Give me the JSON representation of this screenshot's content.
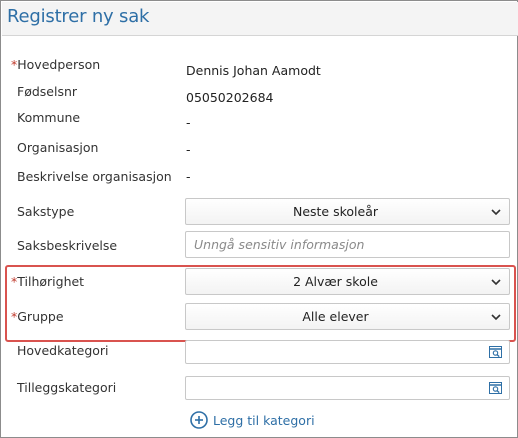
{
  "window": {
    "title": "Registrer ny sak"
  },
  "colors": {
    "accent": "#2e6fa6",
    "required": "#c0392b",
    "highlight": "#d9534f"
  },
  "fields": {
    "hovedperson": {
      "label": "Hovedperson",
      "required_mark": "*",
      "value": "Dennis Johan Aamodt"
    },
    "fodselsnr": {
      "label": "Fødselsnr",
      "value": "05050202684"
    },
    "kommune": {
      "label": "Kommune",
      "value": "-"
    },
    "organisasjon": {
      "label": "Organisasjon",
      "value": "-"
    },
    "beskrivelse_org": {
      "label": "Beskrivelse organisasjon",
      "value": "-"
    },
    "sakstype": {
      "label": "Sakstype",
      "selected": "Neste skoleår",
      "icon": "chevron-down-icon"
    },
    "saksbeskrivelse": {
      "label": "Saksbeskrivelse",
      "placeholder": "Unngå sensitiv informasjon"
    },
    "tilhorighet": {
      "label": "Tilhørighet",
      "required_mark": "*",
      "selected": "2 Alvær skole",
      "icon": "chevron-down-icon"
    },
    "gruppe": {
      "label": "Gruppe",
      "required_mark": "*",
      "selected": "Alle elever",
      "icon": "chevron-down-icon"
    },
    "hovedkategori": {
      "label": "Hovedkategori",
      "value": "",
      "icon": "search-list-icon"
    },
    "tilleggskategori": {
      "label": "Tilleggskategori",
      "value": "",
      "icon": "search-list-icon"
    }
  },
  "actions": {
    "add_category": "Legg til kategori",
    "add_icon": "plus-circle-icon"
  }
}
